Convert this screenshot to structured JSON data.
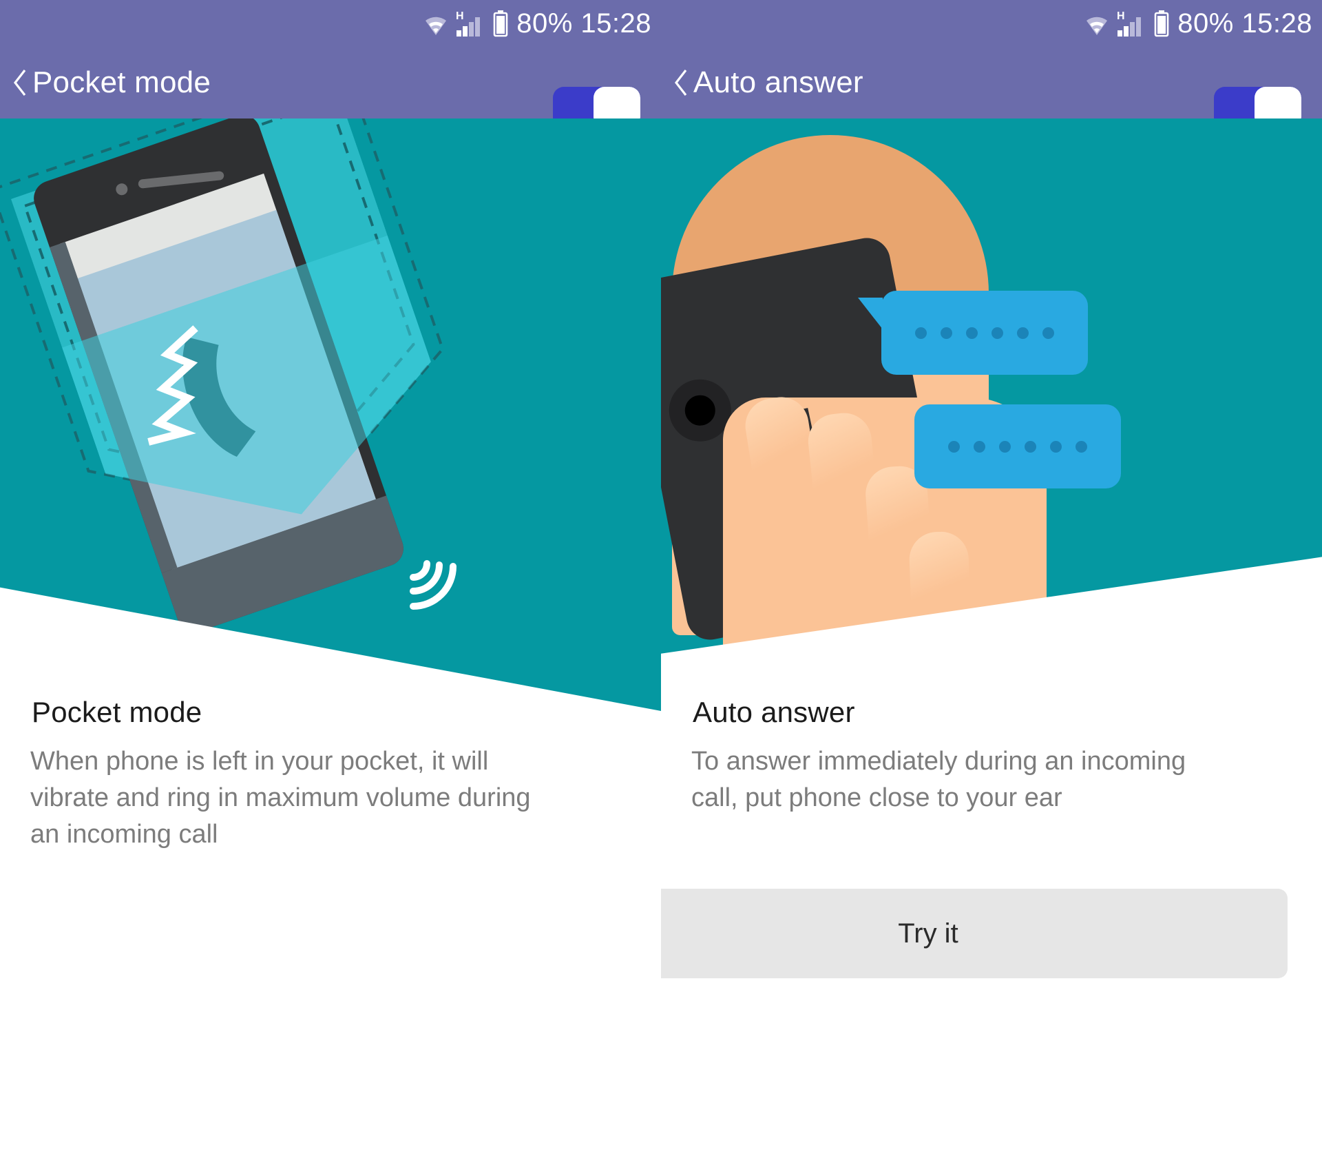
{
  "statusbar": {
    "battery_text": "80%",
    "time": "15:28",
    "combined": "80% 15:28",
    "network_label": "H",
    "icons": [
      "wifi-icon",
      "signal-icon",
      "battery-icon"
    ]
  },
  "colors": {
    "appbar": "#6b6cab",
    "toggle_track_on": "#3b3cc9",
    "toggle_thumb": "#ffffff",
    "illustration_bg": "#0598a1",
    "pocket_fabric": "#40cedc",
    "phone_body": "#2f3032",
    "phone_screen": "#a9c7d9",
    "skin": "#fbc396",
    "hair": "#e8a56f",
    "bubble": "#29a9e1",
    "button_bg": "#e6e6e6",
    "title_text": "#1b1b1b",
    "body_text": "#7c7c7c"
  },
  "panes": [
    {
      "id": "pocket-mode",
      "appbar_title": "Pocket mode",
      "back_icon": "chevron-left-icon",
      "toggle_state": "on",
      "section_title": "Pocket mode",
      "description": "When phone is left in your pocket, it will vibrate and ring in maximum volume during an incoming call",
      "has_button": false,
      "button_label": ""
    },
    {
      "id": "auto-answer",
      "appbar_title": "Auto answer",
      "back_icon": "chevron-left-icon",
      "toggle_state": "on",
      "section_title": "Auto answer",
      "description": "To answer immediately during an incoming call, put phone close to your ear",
      "has_button": true,
      "button_label": "Try it"
    }
  ]
}
